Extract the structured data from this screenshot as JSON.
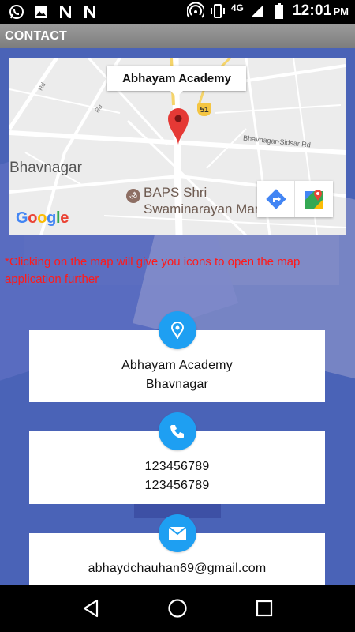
{
  "status_bar": {
    "network": "4G",
    "time": "12:01",
    "ampm": "PM",
    "icons": [
      "whatsapp-icon",
      "image-icon",
      "n-app-icon",
      "n-app-icon",
      "hotspot-icon",
      "vibrate-icon",
      "signal-icon",
      "battery-icon"
    ]
  },
  "app_bar": {
    "title": "CONTACT"
  },
  "map": {
    "callout": "Abhayam Academy",
    "city_label": "Bhavnagar",
    "road_label": "Bhavnagar-Sidsar Rd",
    "road_label_small_1": "Rd",
    "road_label_small_2": "Rd",
    "highway_shield": "51",
    "poi_line1": "BAPS Shri",
    "poi_line2": "Swaminarayan Mandir",
    "logo": [
      "G",
      "o",
      "o",
      "g",
      "l",
      "e"
    ]
  },
  "note": "*Clicking on the map will give you icons to open the map application further",
  "address": {
    "line1": "Abhayam Academy",
    "line2": "Bhavnagar"
  },
  "phone": {
    "line1": "123456789",
    "line2": "123456789"
  },
  "email": {
    "line1": "abhaydchauhan69@gmail.com"
  },
  "colors": {
    "accent": "#1e9ff2",
    "note": "#ff1a1a",
    "pin": "#e53935"
  }
}
